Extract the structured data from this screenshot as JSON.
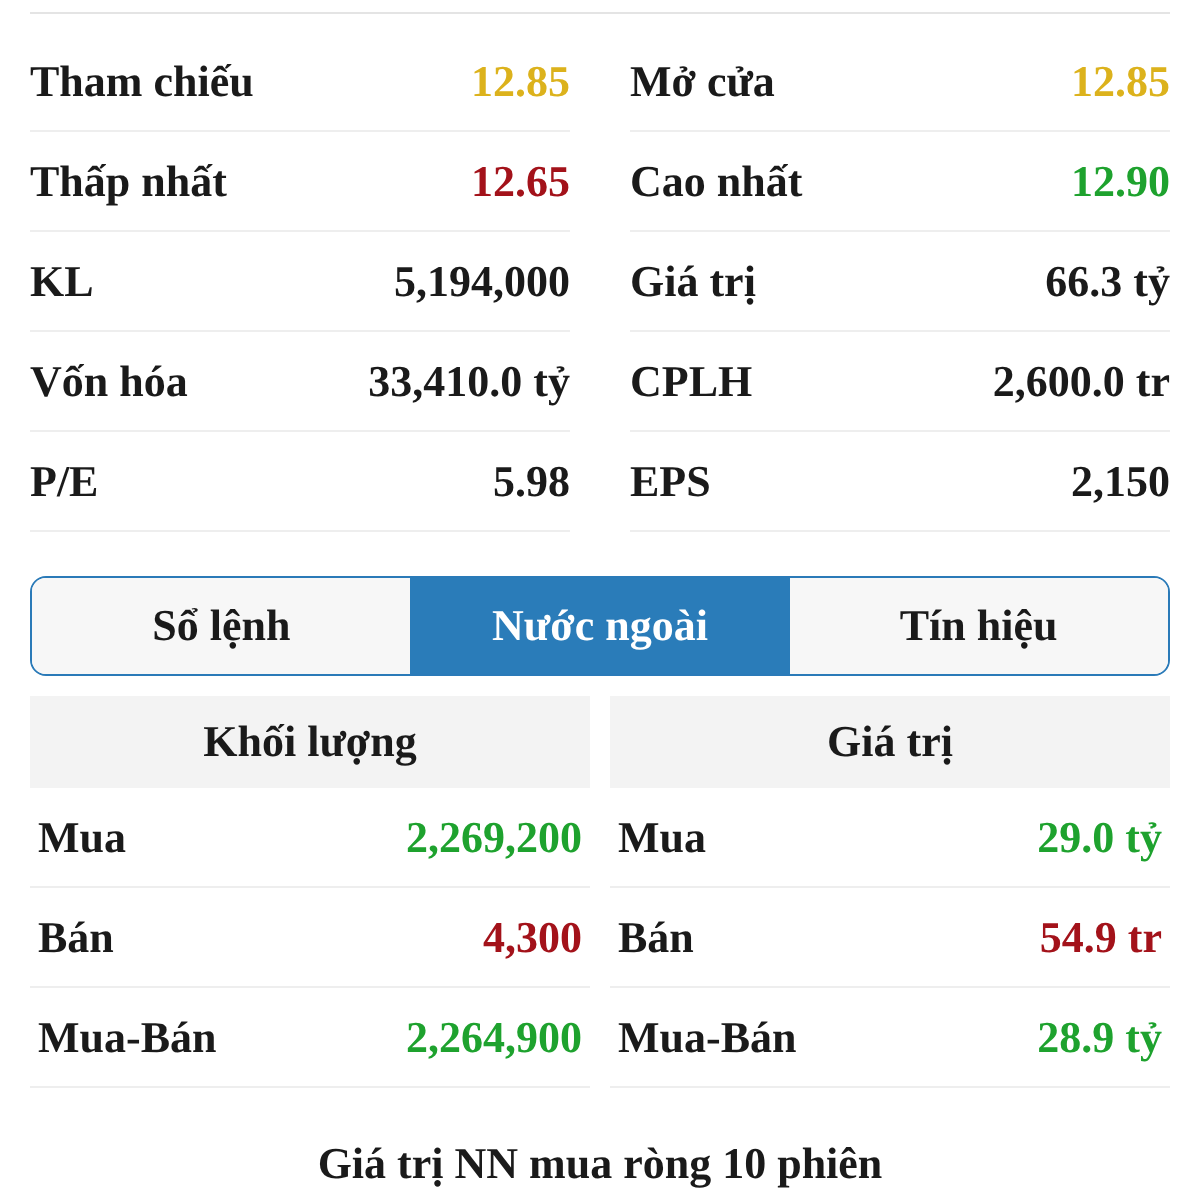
{
  "stats": [
    {
      "label": "Tham chiếu",
      "value": "12.85",
      "color": "#dcb21c"
    },
    {
      "label": "Mở cửa",
      "value": "12.85",
      "color": "#dcb21c"
    },
    {
      "label": "Thấp nhất",
      "value": "12.65",
      "color": "#a3121a"
    },
    {
      "label": "Cao nhất",
      "value": "12.90",
      "color": "#1ea22e"
    },
    {
      "label": "KL",
      "value": "5,194,000",
      "color": "#1a1a1a"
    },
    {
      "label": "Giá trị",
      "value": "66.3 tỷ",
      "color": "#1a1a1a"
    },
    {
      "label": "Vốn hóa",
      "value": "33,410.0 tỷ",
      "color": "#1a1a1a"
    },
    {
      "label": "CPLH",
      "value": "2,600.0 tr",
      "color": "#1a1a1a"
    },
    {
      "label": "P/E",
      "value": "5.98",
      "color": "#1a1a1a"
    },
    {
      "label": "EPS",
      "value": "2,150",
      "color": "#1a1a1a"
    }
  ],
  "tabs": [
    {
      "label": "Sổ lệnh",
      "selected": false
    },
    {
      "label": "Nước ngoài",
      "selected": true
    },
    {
      "label": "Tín hiệu",
      "selected": false
    }
  ],
  "foreign": [
    {
      "header": "Khối lượng",
      "rows": [
        {
          "label": "Mua",
          "value": "2,269,200",
          "color": "#1ea22e"
        },
        {
          "label": "Bán",
          "value": "4,300",
          "color": "#a3121a"
        },
        {
          "label": "Mua-Bán",
          "value": "2,264,900",
          "color": "#1ea22e"
        }
      ]
    },
    {
      "header": "Giá trị",
      "rows": [
        {
          "label": "Mua",
          "value": "29.0 tỷ",
          "color": "#1ea22e"
        },
        {
          "label": "Bán",
          "value": "54.9 tr",
          "color": "#a3121a"
        },
        {
          "label": "Mua-Bán",
          "value": "28.9 tỷ",
          "color": "#1ea22e"
        }
      ]
    }
  ],
  "section_title": "Giá trị NN mua ròng 10 phiên"
}
